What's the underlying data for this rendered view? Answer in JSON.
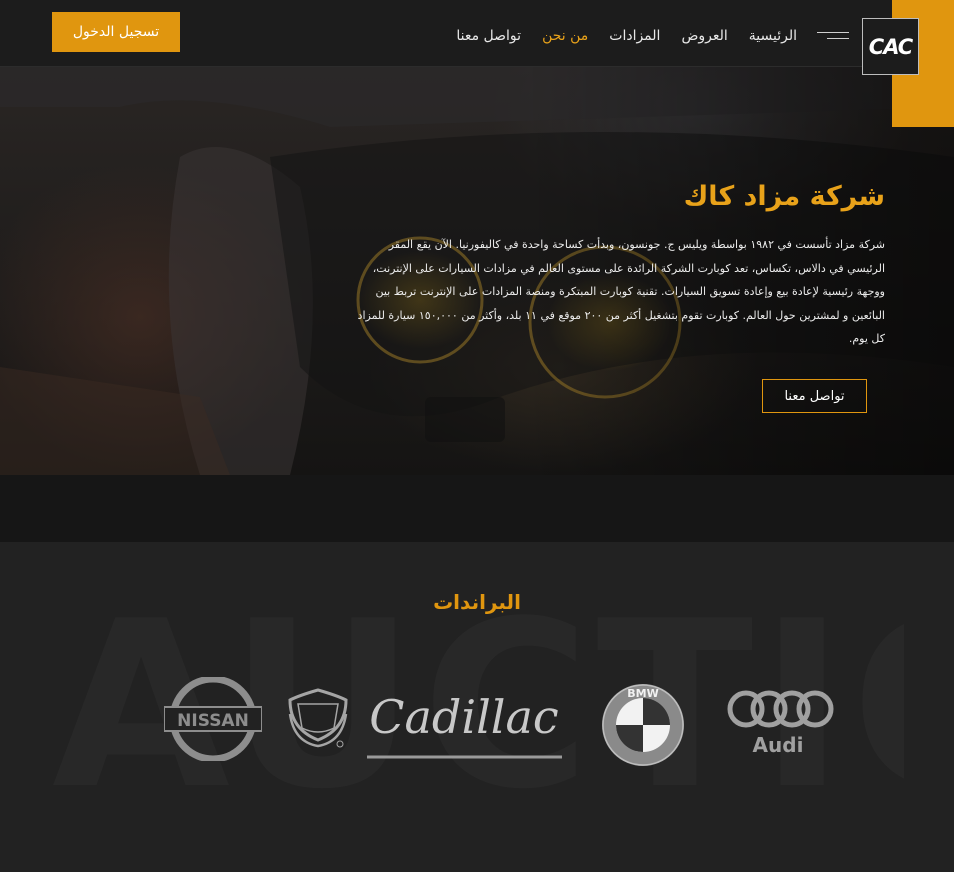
{
  "header": {
    "logo_text": "CAC",
    "login_label": "تسجيل الدخول",
    "nav": [
      {
        "label": "الرئيسية"
      },
      {
        "label": "العروض"
      },
      {
        "label": "المزادات"
      },
      {
        "label": "من نحن",
        "active": true
      },
      {
        "label": "تواصل معنا"
      }
    ]
  },
  "hero": {
    "title": "شركة مزاد كاك",
    "description": "شركة مزاد تأسست في ١٩٨٢ بواسطة ويليس ج. جونسون، وبدأت كساحة واحدة في كاليفورنيا. الآن يقع المقر الرئيسي في دالاس، تكساس، تعد كوبارت الشركة الرائدة على مستوى العالم في مزادات السيارات على الإنترنت، ووجهة رئيسية لإعادة بيع وإعادة تسويق السيارات. تقنية كوبارت المبتكرة ومنصة المزادات على الإنترنت تربط بين البائعين و لمشترين حول العالم. كوبارت تقوم بتشغيل أكثر من ٢٠٠ موقع في ١١ بلد، وأكثر من ١٥٠,٠٠٠ سيارة للمزاد كل يوم.",
    "cta_label": "تواصل معنا"
  },
  "brands": {
    "title": "البراندات",
    "watermark": "AUCTION",
    "logos": [
      {
        "name": "Nissan",
        "text": "NISSAN"
      },
      {
        "name": "Cadillac crest"
      },
      {
        "name": "Cadillac",
        "text": "Cadillac"
      },
      {
        "name": "BMW",
        "text": "BMW"
      },
      {
        "name": "Audi",
        "text": "Audi"
      }
    ]
  },
  "colors": {
    "accent": "#e0960f",
    "header_bg": "#1c1c1c",
    "section_bg": "#222222"
  }
}
